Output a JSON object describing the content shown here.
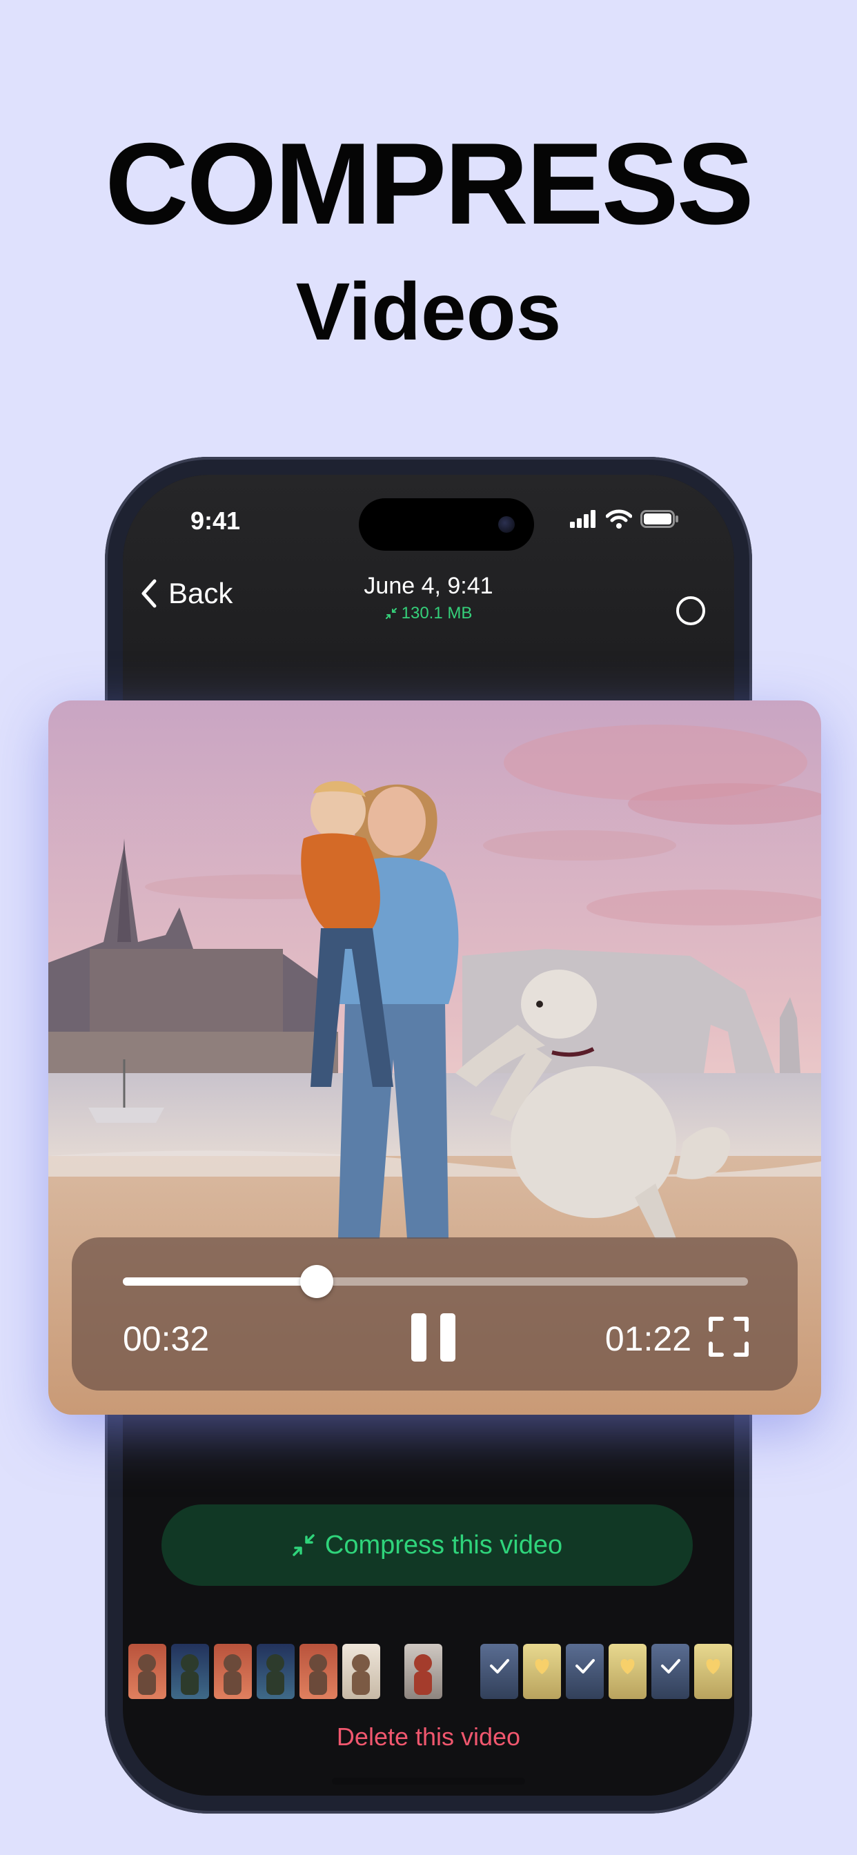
{
  "headline": {
    "title": "COMPRESS",
    "subtitle": "Videos"
  },
  "status_bar": {
    "time": "9:41"
  },
  "nav": {
    "back_label": "Back",
    "date": "June 4, 9:41",
    "size": "130.1 MB",
    "size_color": "#35d07a"
  },
  "player": {
    "current_time": "00:32",
    "duration": "01:22",
    "progress": 0.31
  },
  "actions": {
    "compress_label": "Compress this video",
    "delete_label": "Delete this video"
  },
  "colors": {
    "accent_green": "#2fd47b",
    "button_bg": "#113825",
    "delete_red": "#f0576e",
    "page_bg": "#dfe1fd"
  },
  "thumbnails": [
    {
      "kind": "gorilla-red"
    },
    {
      "kind": "gorilla-blue"
    },
    {
      "kind": "gorilla-red"
    },
    {
      "kind": "gorilla-blue"
    },
    {
      "kind": "gorilla-red"
    },
    {
      "kind": "gorilla-light"
    },
    {
      "kind": "robot"
    },
    {
      "kind": "check-blue"
    },
    {
      "kind": "heart-yellow"
    },
    {
      "kind": "check-blue"
    },
    {
      "kind": "heart-yellow"
    },
    {
      "kind": "check-blue"
    },
    {
      "kind": "heart-yellow"
    }
  ]
}
